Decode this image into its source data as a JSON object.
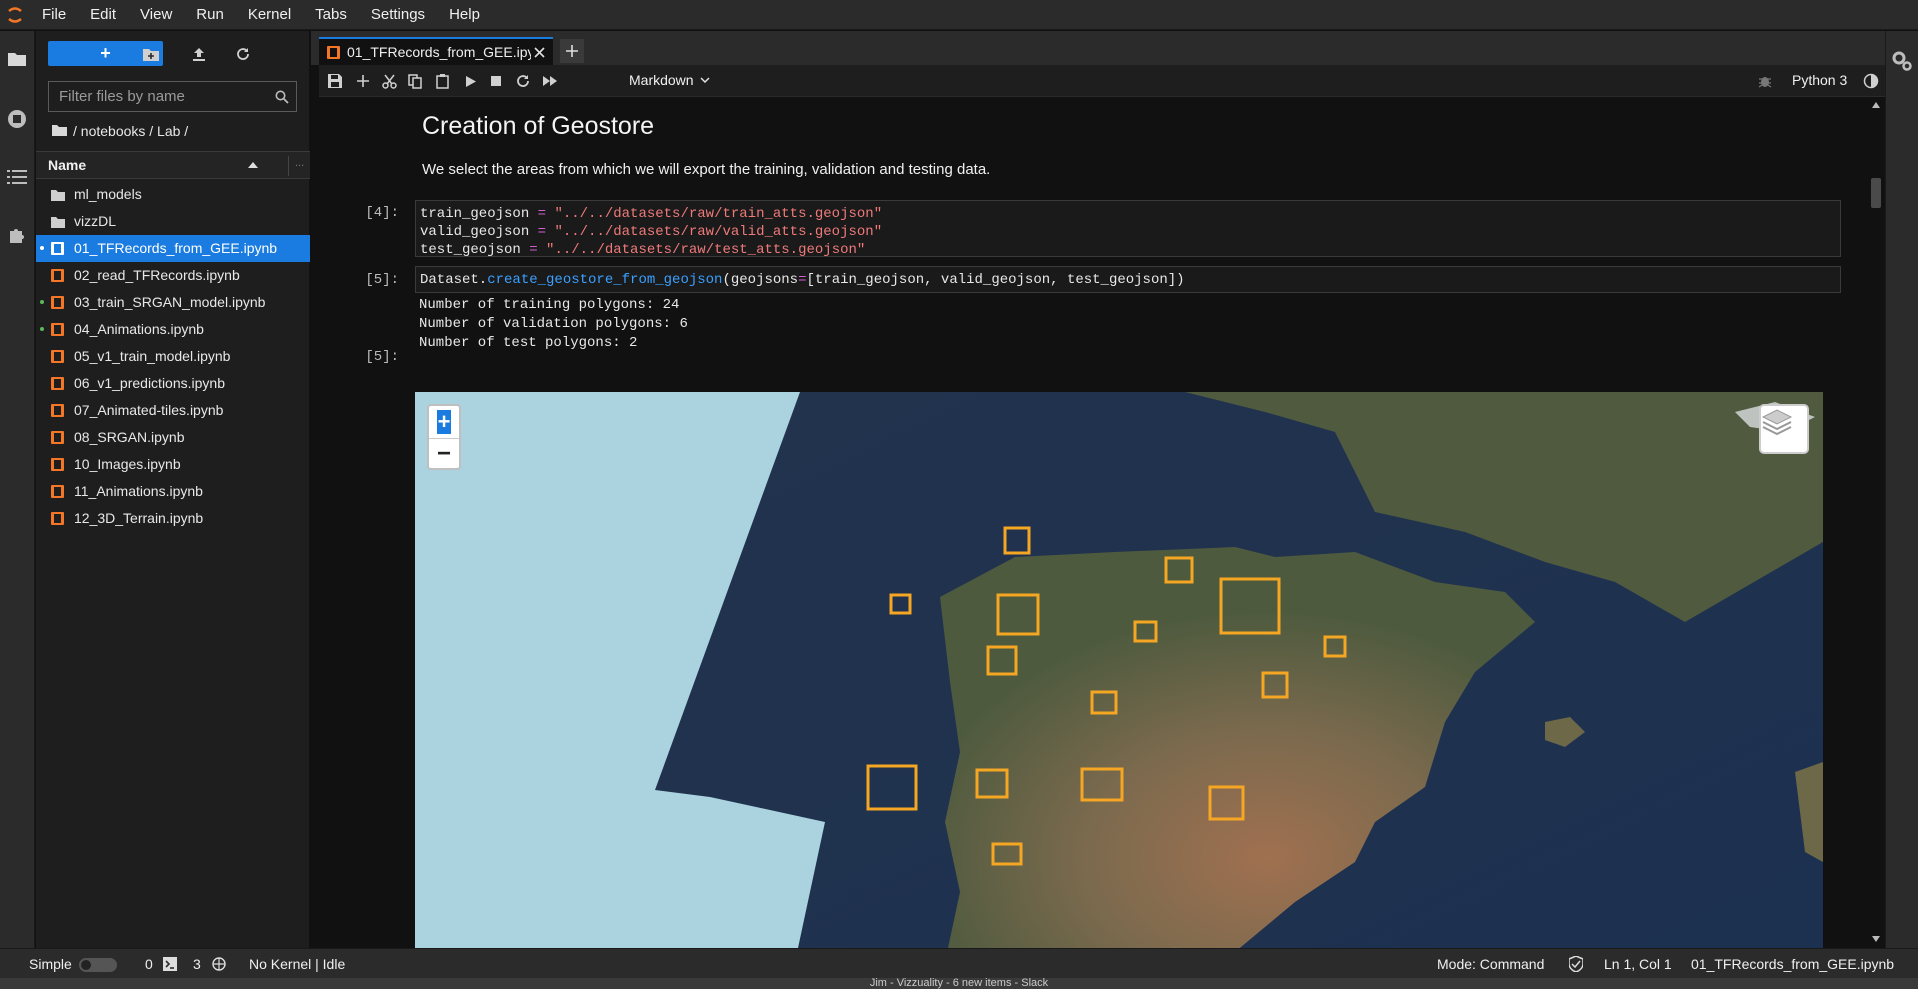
{
  "menu": [
    "File",
    "Edit",
    "View",
    "Run",
    "Kernel",
    "Tabs",
    "Settings",
    "Help"
  ],
  "file_browser": {
    "new_label": "+",
    "filter_placeholder": "Filter files by name",
    "breadcrumb": "/ notebooks / Lab /",
    "header_name": "Name",
    "header_more": "...",
    "items": [
      {
        "name": "ml_models",
        "type": "folder",
        "running": false,
        "selected": false
      },
      {
        "name": "vizzDL",
        "type": "folder",
        "running": false,
        "selected": false
      },
      {
        "name": "01_TFRecords_from_GEE.ipynb",
        "type": "notebook",
        "running": true,
        "selected": true
      },
      {
        "name": "02_read_TFRecords.ipynb",
        "type": "notebook",
        "running": false,
        "selected": false
      },
      {
        "name": "03_train_SRGAN_model.ipynb",
        "type": "notebook",
        "running": true,
        "selected": false
      },
      {
        "name": "04_Animations.ipynb",
        "type": "notebook",
        "running": true,
        "selected": false
      },
      {
        "name": "05_v1_train_model.ipynb",
        "type": "notebook",
        "running": false,
        "selected": false
      },
      {
        "name": "06_v1_predictions.ipynb",
        "type": "notebook",
        "running": false,
        "selected": false
      },
      {
        "name": "07_Animated-tiles.ipynb",
        "type": "notebook",
        "running": false,
        "selected": false
      },
      {
        "name": "08_SRGAN.ipynb",
        "type": "notebook",
        "running": false,
        "selected": false
      },
      {
        "name": "10_Images.ipynb",
        "type": "notebook",
        "running": false,
        "selected": false
      },
      {
        "name": "11_Animations.ipynb",
        "type": "notebook",
        "running": false,
        "selected": false
      },
      {
        "name": "12_3D_Terrain.ipynb",
        "type": "notebook",
        "running": false,
        "selected": false
      }
    ]
  },
  "tab": {
    "label": "01_TFRecords_from_GEE.ipynb"
  },
  "notebook_toolbar": {
    "cell_type": "Markdown",
    "kernel": "Python 3"
  },
  "notebook": {
    "heading": "Creation of Geostore",
    "paragraph": "We select the areas from which we will export the training, validation and testing data.",
    "cell4_prompt": "[4]:",
    "cell4": [
      {
        "var": "train_geojson",
        "op": "=",
        "str": "\"../../datasets/raw/train_atts.geojson\""
      },
      {
        "var": "valid_geojson",
        "op": "=",
        "str": "\"../../datasets/raw/valid_atts.geojson\""
      },
      {
        "var": "test_geojson",
        "op": "=",
        "str": "\"../../datasets/raw/test_atts.geojson\""
      }
    ],
    "cell5_prompt": "[5]:",
    "cell5_code": {
      "obj": "Dataset.",
      "fn": "create_geostore_from_geojson",
      "open": "(geojsons",
      "op": "=",
      "args": "[train_geojson, valid_geojson, test_geojson])"
    },
    "cell5_output": [
      "Number of training polygons: 24",
      "Number of validation polygons: 6",
      "Number of test polygons: 2"
    ],
    "out5_prompt": "[5]:",
    "map": {
      "zoom_in": "+",
      "zoom_out": "−"
    }
  },
  "status_bar": {
    "mode_label": "Simple",
    "count_a": "0",
    "count_b": "3",
    "kernel_status": "No Kernel | Idle",
    "mode": "Mode: Command",
    "cursor": "Ln 1, Col 1",
    "file": "01_TFRecords_from_GEE.ipynb"
  },
  "bottom_strip": "Jim - Vizzuality - 6 new items - Slack",
  "colors": {
    "accent": "#1a7be0",
    "notebook_icon": "#f37726",
    "running_dot": "#5cb85c",
    "polygon": "#f5a623"
  }
}
